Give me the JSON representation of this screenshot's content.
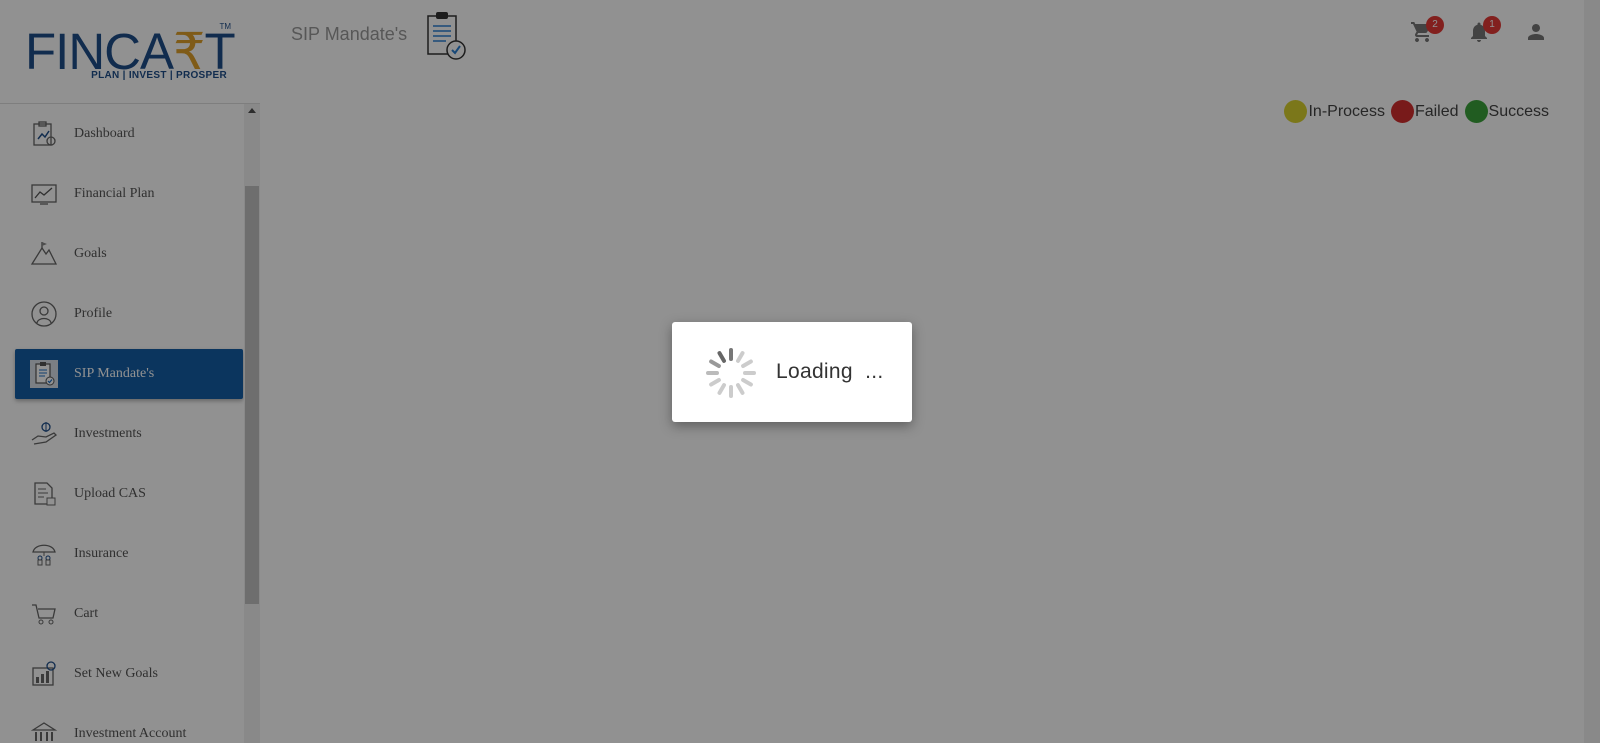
{
  "brand": {
    "logo_text_a": "FINCA",
    "logo_text_rupee": "₹",
    "logo_text_b": "T",
    "trademark": "TM",
    "tagline": "PLAN | INVEST | PROSPER"
  },
  "header": {
    "title": "SIP Mandate's",
    "cart_badge": "2",
    "notification_badge": "1"
  },
  "sidebar": {
    "items": [
      {
        "label": "Dashboard",
        "icon": "dashboard-icon"
      },
      {
        "label": "Financial Plan",
        "icon": "chart-icon"
      },
      {
        "label": "Goals",
        "icon": "mountain-flag-icon"
      },
      {
        "label": "Profile",
        "icon": "user-circle-icon"
      },
      {
        "label": "SIP Mandate's",
        "icon": "clipboard-check-icon",
        "active": true
      },
      {
        "label": "Investments",
        "icon": "hand-money-icon"
      },
      {
        "label": "Upload CAS",
        "icon": "document-upload-icon"
      },
      {
        "label": "Insurance",
        "icon": "umbrella-family-icon"
      },
      {
        "label": "Cart",
        "icon": "cart-icon"
      },
      {
        "label": "Set New Goals",
        "icon": "target-chart-icon"
      },
      {
        "label": "Investment Account",
        "icon": "bank-icon"
      }
    ]
  },
  "legend": [
    {
      "label": "In-Process",
      "color": "#d9d12e"
    },
    {
      "label": "Failed",
      "color": "#d32f2f"
    },
    {
      "label": "Success",
      "color": "#3aa33a"
    }
  ],
  "loading": {
    "text": "Loading  ..."
  },
  "colors": {
    "brand_blue": "#1f4e8a",
    "active_nav": "#155ea6",
    "rupee_accent": "#e0a12b",
    "badge_red": "#e53935"
  }
}
